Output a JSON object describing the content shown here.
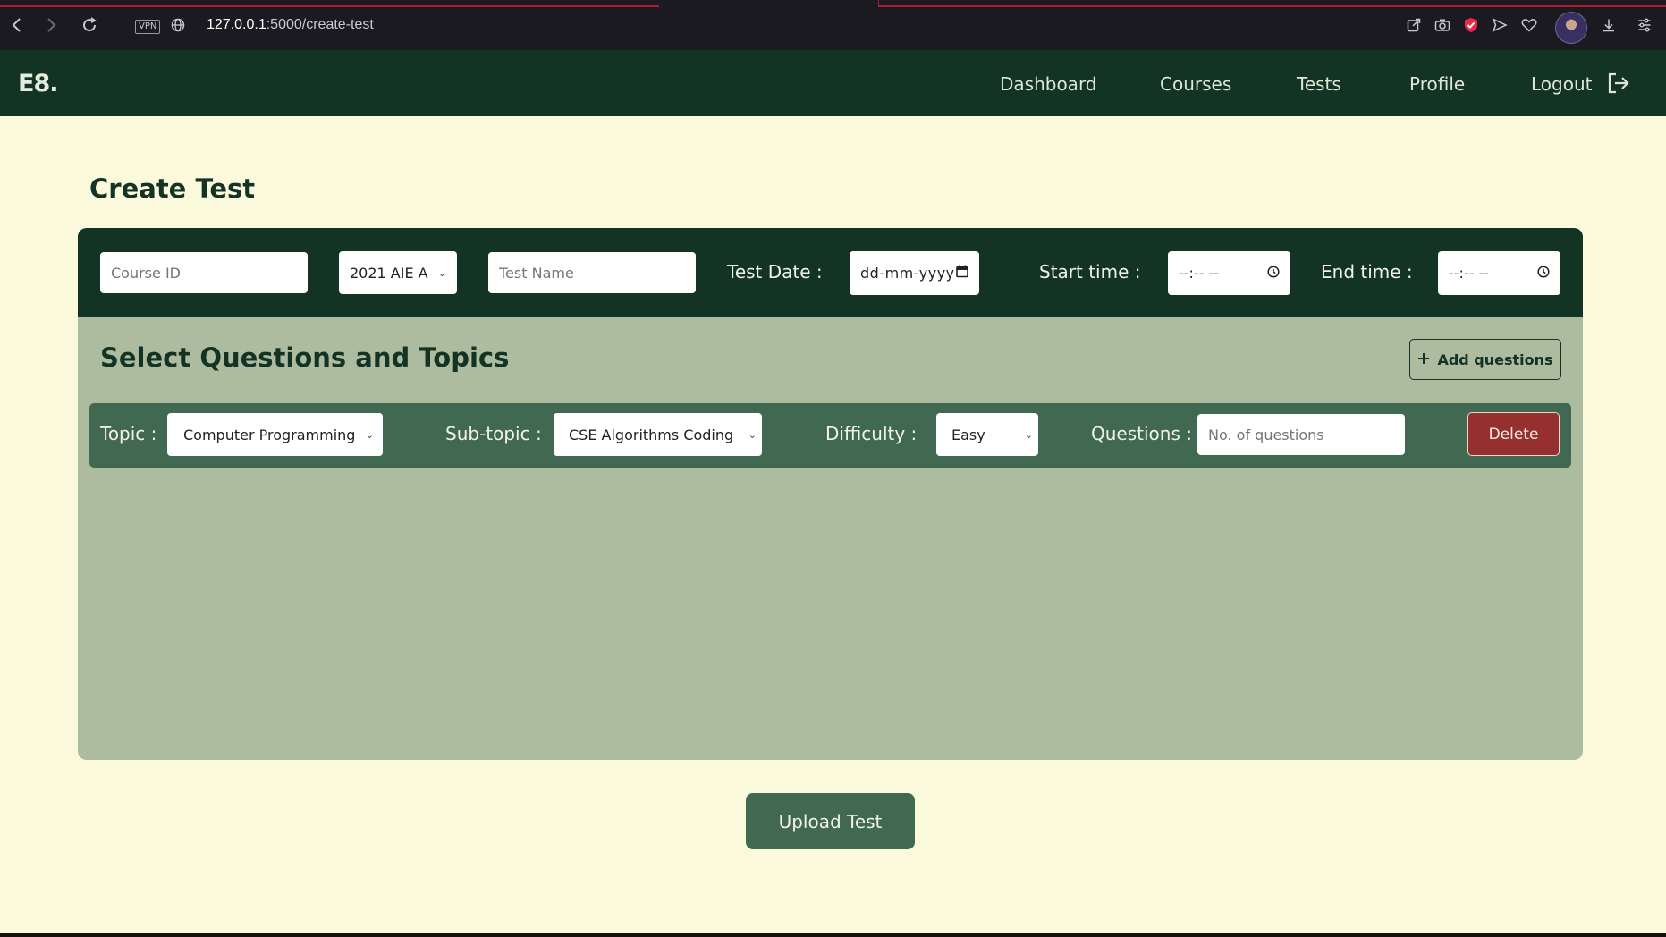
{
  "browser": {
    "vpn_label": "VPN",
    "url_host": "127.0.0.1",
    "url_path": ":5000/create-test"
  },
  "navbar": {
    "logo": "E8.",
    "links": [
      "Dashboard",
      "Courses",
      "Tests",
      "Profile",
      "Logout"
    ]
  },
  "page": {
    "title": "Create Test"
  },
  "form": {
    "course_id_placeholder": "Course ID",
    "batch_selected": "2021 AIE A",
    "test_name_placeholder": "Test Name",
    "test_date_label": "Test Date :",
    "test_date_placeholder": "dd-mm-yyyy",
    "start_time_label": "Start time :",
    "start_time_placeholder": "--:-- --",
    "end_time_label": "End time :",
    "end_time_placeholder": "--:-- --"
  },
  "questions": {
    "section_title": "Select Questions and Topics",
    "add_button": "Add questions",
    "row": {
      "topic_label": "Topic :",
      "topic_selected": "Computer Programming",
      "subtopic_label": "Sub-topic :",
      "subtopic_selected": "CSE Algorithms Coding",
      "difficulty_label": "Difficulty :",
      "difficulty_selected": "Easy",
      "questions_label": "Questions :",
      "questions_placeholder": "No. of questions",
      "delete_button": "Delete"
    }
  },
  "actions": {
    "upload_button": "Upload Test"
  },
  "colors": {
    "background": "#faf9dc",
    "dark_green": "#133324",
    "mid_green": "#416850",
    "sage": "#adbb9f",
    "delete_red": "#96302f"
  }
}
